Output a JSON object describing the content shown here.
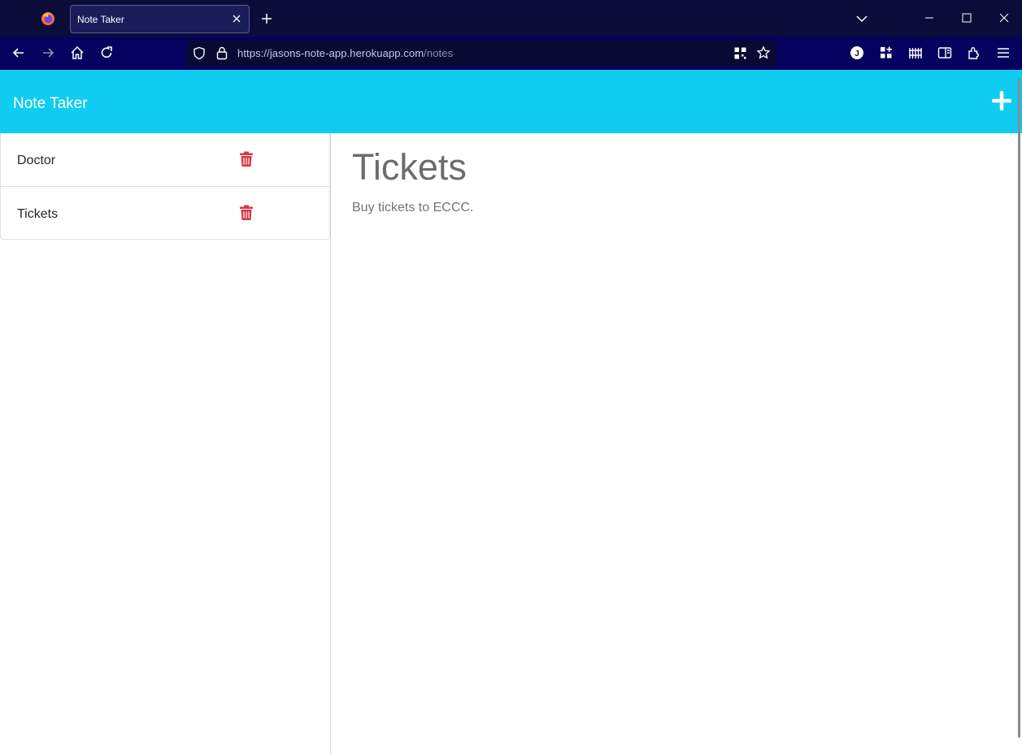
{
  "browser": {
    "tab_title": "Note Taker",
    "url_host": "https://jasons-note-app.herokuapp.com",
    "url_path": "/notes",
    "profile_initial": "J"
  },
  "app": {
    "brand": "Note Taker",
    "notes": [
      {
        "title": "Doctor"
      },
      {
        "title": "Tickets"
      }
    ],
    "active_note": {
      "title": "Tickets",
      "body": "Buy tickets to ECCC."
    }
  },
  "colors": {
    "header": "#10ccf0",
    "trash": "#dc3545"
  }
}
